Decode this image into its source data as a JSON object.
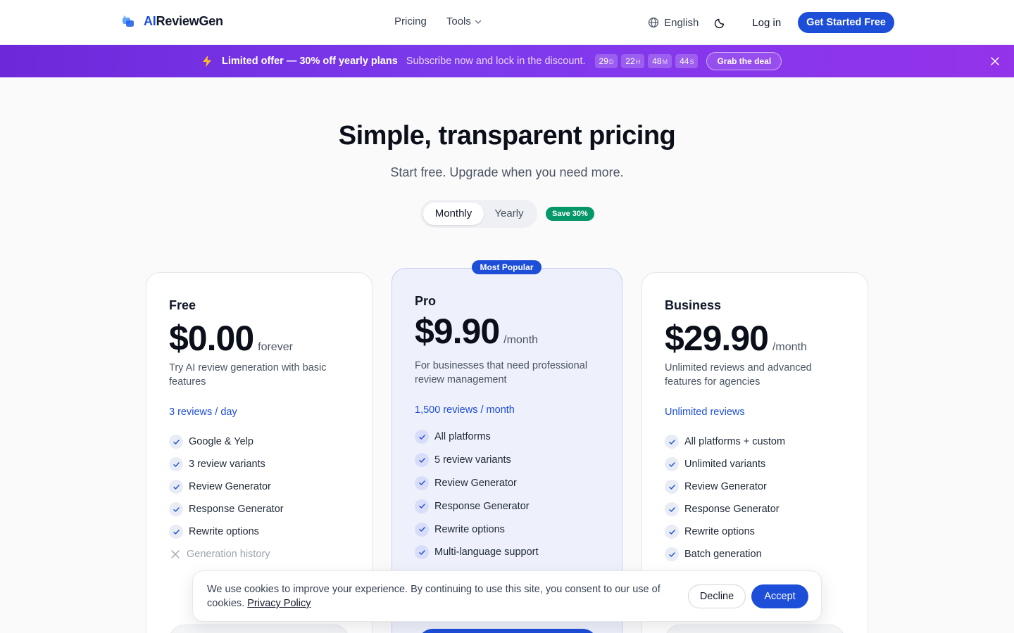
{
  "header": {
    "logo_prefix": "AI",
    "logo_suffix": "ReviewGen",
    "nav": [
      {
        "label": "Pricing"
      },
      {
        "label": "Tools"
      }
    ],
    "language": "English",
    "login_label": "Log in",
    "cta_label": "Get Started Free"
  },
  "promo": {
    "title": "Limited offer — 30% off yearly plans",
    "subtitle": "Subscribe now and lock in the discount.",
    "countdown": [
      {
        "value": "29",
        "unit": "D"
      },
      {
        "value": "22",
        "unit": "H"
      },
      {
        "value": "48",
        "unit": "M"
      },
      {
        "value": "44",
        "unit": "S"
      }
    ],
    "button_label": "Grab the deal"
  },
  "hero": {
    "title": "Simple, transparent pricing",
    "subtitle": "Start free. Upgrade when you need more."
  },
  "billing": {
    "monthly_label": "Monthly",
    "yearly_label": "Yearly",
    "selected": "Monthly",
    "save_badge": "Save 30%"
  },
  "plans": {
    "free": {
      "name": "Free",
      "price": "$0.00",
      "period": "forever",
      "description": "Try AI review generation with basic features",
      "quota": "3 reviews / day",
      "features": [
        {
          "label": "Google & Yelp",
          "included": true
        },
        {
          "label": "3 review variants",
          "included": true
        },
        {
          "label": "Review Generator",
          "included": true
        },
        {
          "label": "Response Generator",
          "included": true
        },
        {
          "label": "Rewrite options",
          "included": true
        },
        {
          "label": "Generation history",
          "included": false
        }
      ]
    },
    "pro": {
      "badge": "Most Popular",
      "name": "Pro",
      "price": "$9.90",
      "period": "/month",
      "description": "For businesses that need professional review management",
      "quota": "1,500 reviews / month",
      "features": [
        {
          "label": "All platforms",
          "included": true
        },
        {
          "label": "5 review variants",
          "included": true
        },
        {
          "label": "Review Generator",
          "included": true
        },
        {
          "label": "Response Generator",
          "included": true
        },
        {
          "label": "Rewrite options",
          "included": true
        },
        {
          "label": "Multi-language support",
          "included": true
        }
      ]
    },
    "business": {
      "name": "Business",
      "price": "$29.90",
      "period": "/month",
      "description": "Unlimited reviews and advanced features for agencies",
      "quota": "Unlimited reviews",
      "features": [
        {
          "label": "All platforms + custom",
          "included": true
        },
        {
          "label": "Unlimited variants",
          "included": true
        },
        {
          "label": "Review Generator",
          "included": true
        },
        {
          "label": "Response Generator",
          "included": true
        },
        {
          "label": "Rewrite options",
          "included": true
        },
        {
          "label": "Batch generation",
          "included": true
        }
      ]
    }
  },
  "cookie": {
    "text": "We use cookies to improve your experience. By continuing to use this site, you consent to our use of cookies.",
    "link_label": "Privacy Policy",
    "decline_label": "Decline",
    "accept_label": "Accept"
  },
  "colors": {
    "accent": "#1d4ed8",
    "promo_start": "#6d28d9",
    "promo_end": "#9333ea",
    "save_badge": "#059669"
  }
}
